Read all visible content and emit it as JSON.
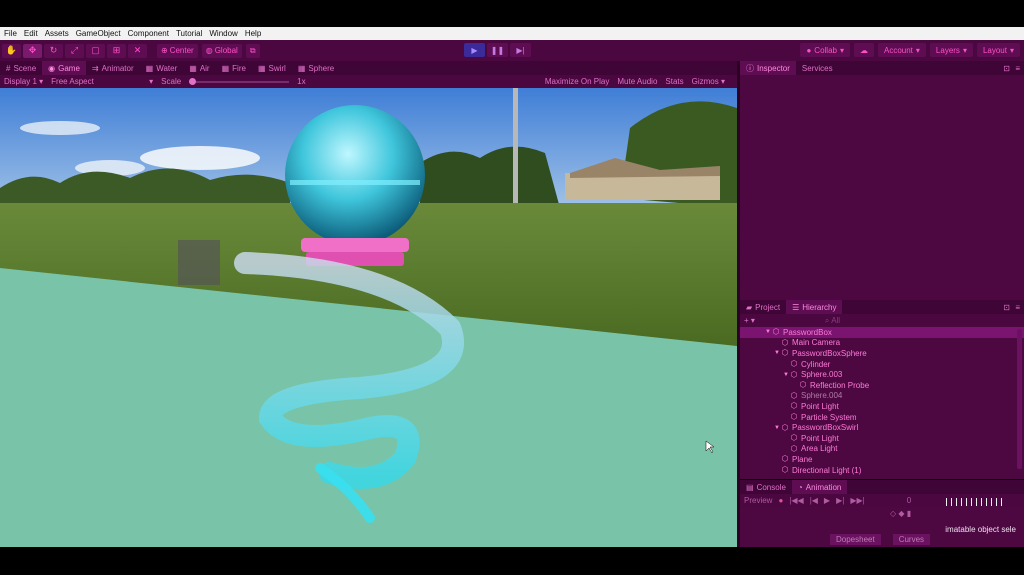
{
  "menu": [
    "File",
    "Edit",
    "Assets",
    "GameObject",
    "Component",
    "Tutorial",
    "Window",
    "Help"
  ],
  "toolbar": {
    "tools": [
      "hand-icon",
      "move-icon",
      "rotate-icon",
      "scale-icon",
      "rect-icon",
      "transform-icon",
      "custom-tool-icon"
    ],
    "center_label": "Center",
    "global_label": "Global",
    "collab_label": "Collab",
    "account_label": "Account",
    "layers_label": "Layers",
    "layout_label": "Layout"
  },
  "scene_tabs": [
    {
      "label": "Scene",
      "icon": "scene-icon"
    },
    {
      "label": "Game",
      "icon": "game-icon"
    },
    {
      "label": "Animator",
      "icon": "animator-icon"
    },
    {
      "label": "Water",
      "icon": "water-icon"
    },
    {
      "label": "Air",
      "icon": "air-icon"
    },
    {
      "label": "Fire",
      "icon": "fire-icon"
    },
    {
      "label": "Swirl",
      "icon": "swirl-icon"
    },
    {
      "label": "Sphere",
      "icon": "sphere-icon"
    }
  ],
  "game_bar": {
    "display": "Display 1",
    "aspect": "Free Aspect",
    "scale_label": "Scale",
    "scale_value": "1x",
    "maximize": "Maximize On Play",
    "mute": "Mute Audio",
    "stats": "Stats",
    "gizmos": "Gizmos"
  },
  "inspector_tabs": [
    "Inspector",
    "Services"
  ],
  "hierarchy_tabs": [
    "Project",
    "Hierarchy"
  ],
  "hierarchy_search": "All",
  "hierarchy": [
    {
      "label": "PasswordBox",
      "depth": 0,
      "root": true,
      "arrow": "▼"
    },
    {
      "label": "Main Camera",
      "depth": 1,
      "arrow": ""
    },
    {
      "label": "PasswordBoxSphere",
      "depth": 1,
      "arrow": "▼"
    },
    {
      "label": "Cylinder",
      "depth": 2,
      "arrow": ""
    },
    {
      "label": "Sphere.003",
      "depth": 2,
      "arrow": "▼"
    },
    {
      "label": "Reflection Probe",
      "depth": 3,
      "arrow": ""
    },
    {
      "label": "Sphere.004",
      "depth": 2,
      "arrow": "",
      "dim": true
    },
    {
      "label": "Point Light",
      "depth": 2,
      "arrow": ""
    },
    {
      "label": "Particle System",
      "depth": 2,
      "arrow": ""
    },
    {
      "label": "PasswordBoxSwirl",
      "depth": 1,
      "arrow": "▼"
    },
    {
      "label": "Point Light",
      "depth": 2,
      "arrow": ""
    },
    {
      "label": "Area Light",
      "depth": 2,
      "arrow": ""
    },
    {
      "label": "Plane",
      "depth": 1,
      "arrow": ""
    },
    {
      "label": "Directional Light (1)",
      "depth": 1,
      "arrow": ""
    }
  ],
  "bottom_tabs": [
    "Console",
    "Animation"
  ],
  "animation": {
    "preview_label": "Preview",
    "frame_value": "0",
    "message": "imatable object sele",
    "dopesheet_label": "Dopesheet",
    "curves_label": "Curves"
  },
  "colors": {
    "accent": "#ff4fc8",
    "panel": "#4d0842",
    "toolbar": "#4a0740"
  }
}
